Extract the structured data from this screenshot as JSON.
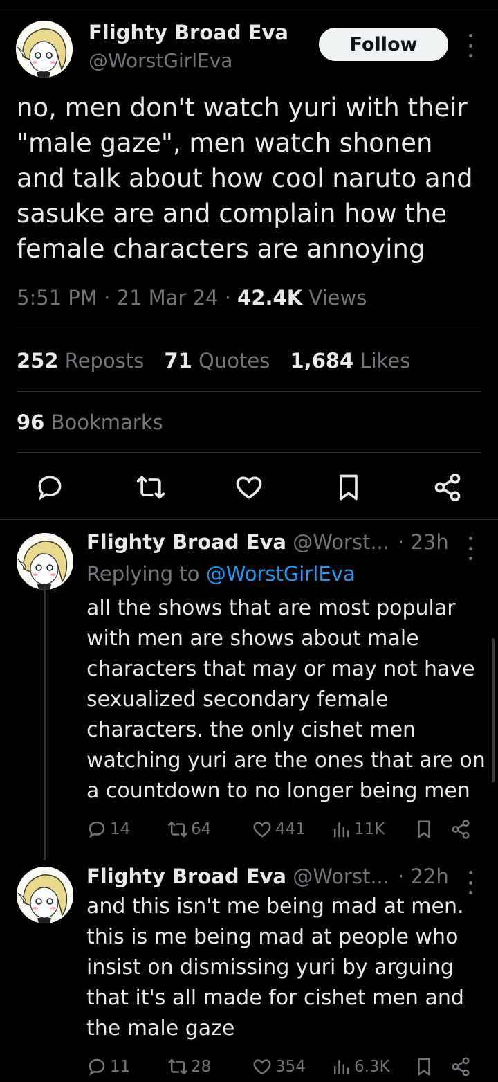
{
  "colors": {
    "background": "#000000",
    "text": "#e7e9ea",
    "muted": "#71767b",
    "link": "#1d9bf0",
    "divider": "#2f3336"
  },
  "main_tweet": {
    "author_name": "Flighty Broad Eva",
    "author_handle": "@WorstGirlEva",
    "follow_label": "Follow",
    "text_lines": [
      "no, men don't watch yuri with their",
      "\"male gaze\", men watch shonen",
      "and talk about how cool naruto and",
      "sasuke are and complain how the",
      "female characters are annoying"
    ],
    "time": "5:51 PM",
    "date": "21 Mar 24",
    "views_count": "42.4K",
    "views_label": "Views",
    "reposts_count": "252",
    "reposts_label": "Reposts",
    "quotes_count": "71",
    "quotes_label": "Quotes",
    "likes_count": "1,684",
    "likes_label": "Likes",
    "bookmarks_count": "96",
    "bookmarks_label": "Bookmarks",
    "actions": [
      "reply-icon",
      "repost-icon",
      "like-icon",
      "bookmark-icon",
      "share-icon"
    ]
  },
  "replies": [
    {
      "author_name": "Flighty Broad Eva",
      "author_handle": "@Worst...",
      "time": "· 23h",
      "replying_prefix": "Replying to",
      "replying_to": "@WorstGirlEva",
      "text_lines": [
        "all the shows that are most popular",
        "with men are shows about male",
        "characters that may or may not have",
        "sexualized secondary female",
        "characters. the only cishet men",
        "watching yuri are the ones that are on",
        "a countdown to no longer being men"
      ],
      "replies": "14",
      "reposts": "64",
      "likes": "441",
      "views": "11K"
    },
    {
      "author_name": "Flighty Broad Eva",
      "author_handle": "@Worst...",
      "time": "· 22h",
      "text_lines": [
        "and this isn't me being mad at men.",
        "this is me being mad at people who",
        "insist on dismissing yuri by arguing",
        "that it's all made for cishet men and",
        "the male gaze"
      ],
      "replies": "11",
      "reposts": "28",
      "likes": "354",
      "views": "6.3K"
    }
  ]
}
